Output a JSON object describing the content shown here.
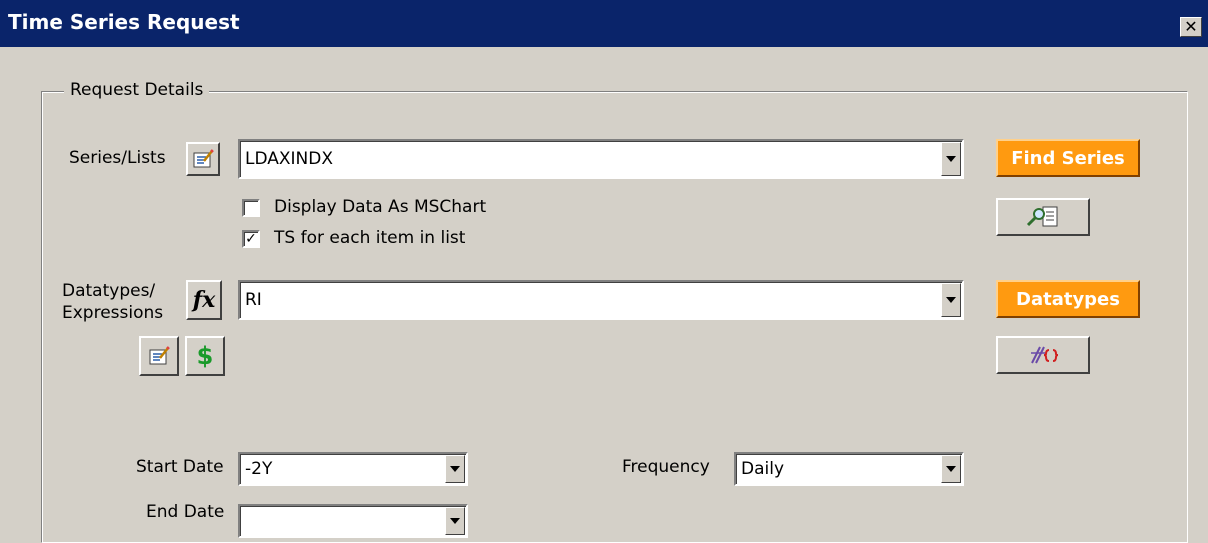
{
  "window": {
    "title": "Time Series Request",
    "close_glyph": "✕"
  },
  "group": {
    "legend": "Request Details"
  },
  "series": {
    "label": "Series/Lists",
    "value": "LDAXINDX",
    "find_button": "Find Series"
  },
  "options": {
    "display_chart": {
      "label": "Display Data As MSChart",
      "checked": false
    },
    "ts_each": {
      "label": "TS for each item in list",
      "checked": true,
      "mark": "✓"
    }
  },
  "datatypes": {
    "label_line1": "Datatypes/",
    "label_line2": "Expressions",
    "value": "RI",
    "fx_glyph": "fx",
    "dollar_glyph": "$",
    "button": "Datatypes"
  },
  "dates": {
    "start_label": "Start Date",
    "start_value": "-2Y",
    "end_label": "End Date",
    "end_value": ""
  },
  "frequency": {
    "label": "Frequency",
    "value": "Daily"
  },
  "colors": {
    "titlebar": "#0a246a",
    "accent": "#ff9a10",
    "face": "#d4d0c8"
  }
}
